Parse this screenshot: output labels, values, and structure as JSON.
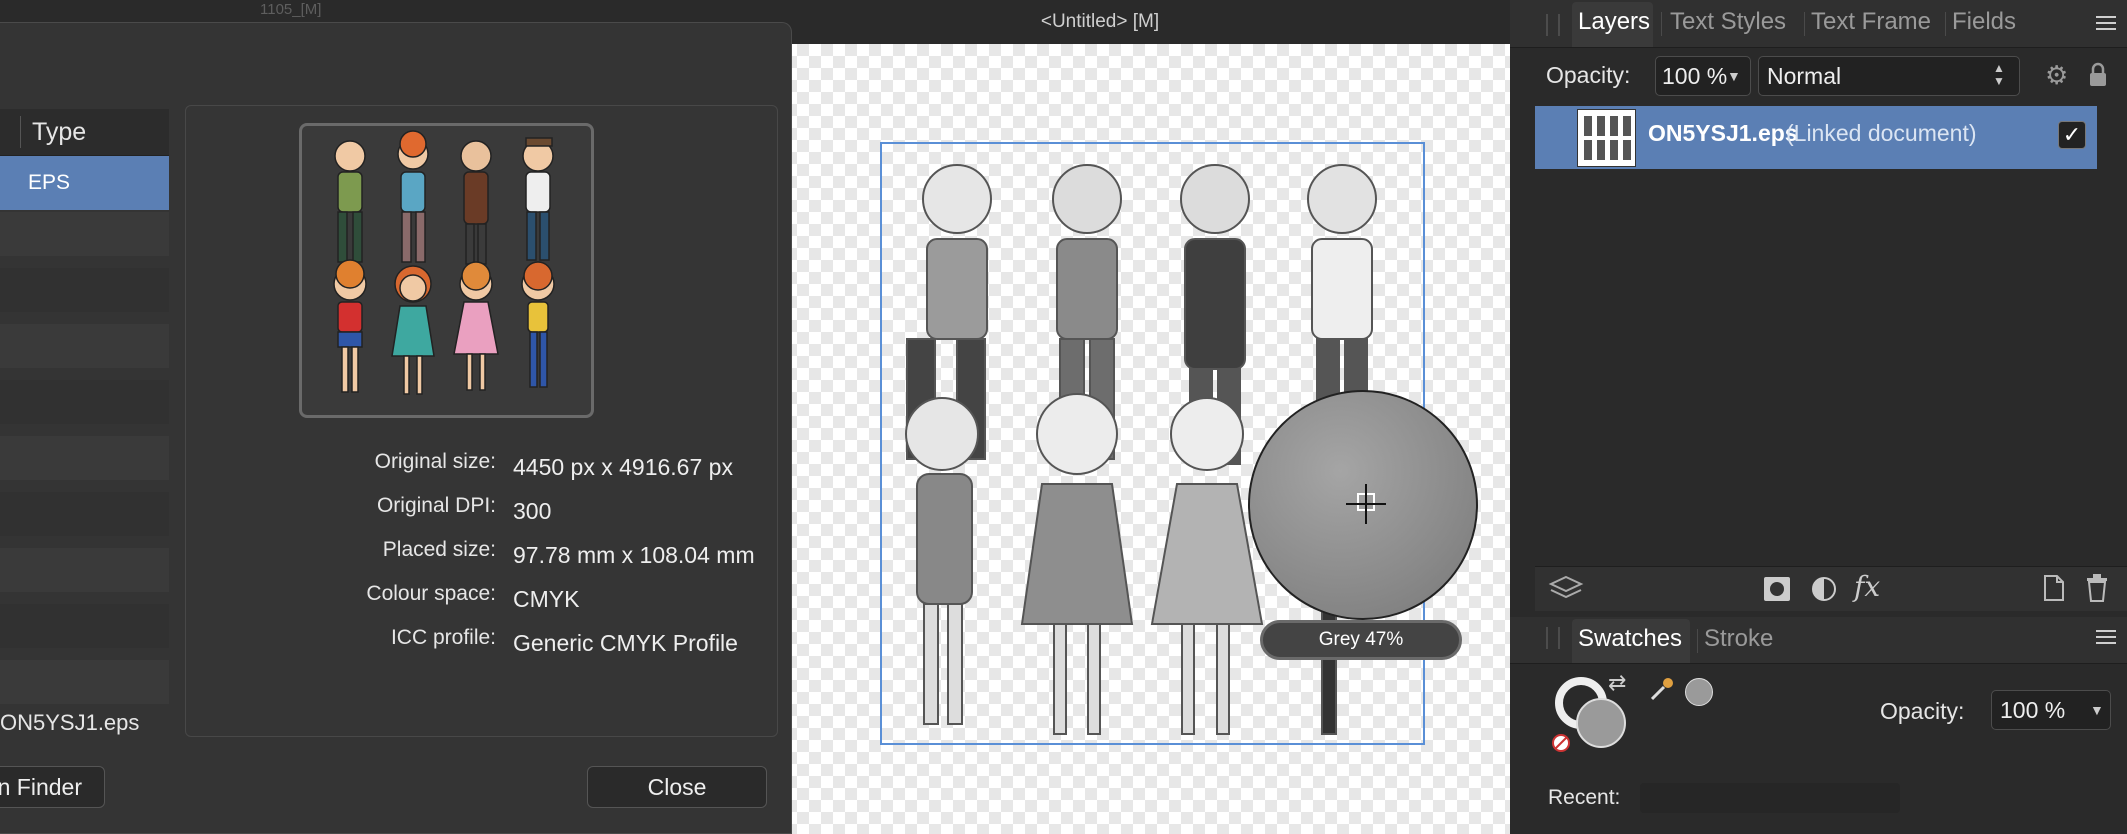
{
  "document": {
    "title": "<Untitled> [M]",
    "background_tab_hint": "1105_[M]"
  },
  "dialog": {
    "column_header_type": "Type",
    "selected_type": "EPS",
    "file_name": "ON5YSJ1.eps",
    "show_in_finder_label": "n Finder",
    "close_label": "Close",
    "properties": [
      {
        "label": "Original size:",
        "value": "4450 px x 4916.67 px"
      },
      {
        "label": "Original DPI:",
        "value": "300"
      },
      {
        "label": "Placed size:",
        "value": "97.78 mm x 108.04 mm"
      },
      {
        "label": "Colour space:",
        "value": "CMYK"
      },
      {
        "label": "ICC profile:",
        "value": "Generic CMYK Profile"
      }
    ]
  },
  "canvas": {
    "loupe_label": "Grey 47%"
  },
  "layers_panel": {
    "tabs": [
      "Layers",
      "Text Styles",
      "Text Frame",
      "Fields"
    ],
    "active_tab": "Layers",
    "opacity_label": "Opacity:",
    "opacity_value": "100 %",
    "blend_mode": "Normal",
    "layer": {
      "name": "ON5YSJ1.eps",
      "note": "(Linked document)",
      "visible_check": "✓"
    }
  },
  "swatches_panel": {
    "tabs": [
      "Swatches",
      "Stroke"
    ],
    "active_tab": "Swatches",
    "opacity_label": "Opacity:",
    "opacity_value": "100 %",
    "recent_label": "Recent:"
  },
  "colors": {
    "selection_blue": "#5b7fb4",
    "canvas_frame": "#5a8fd6",
    "panel_bg": "#2a2a2a"
  }
}
